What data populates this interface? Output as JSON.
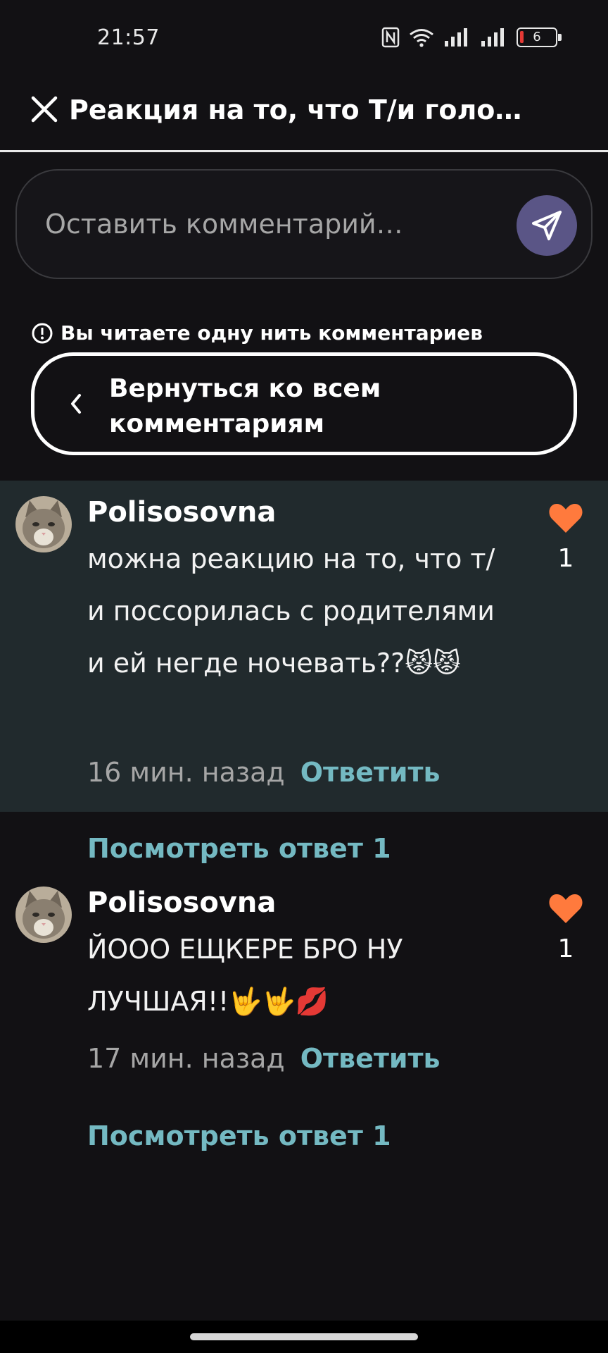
{
  "status_bar": {
    "time": "21:57",
    "battery": "6",
    "icons": [
      "nfc-icon",
      "wifi-icon",
      "signal-icon",
      "signal-icon",
      "battery-icon"
    ]
  },
  "header": {
    "title": "Реакция на то, что Т/и голо…",
    "close_icon": "close-icon"
  },
  "composer": {
    "placeholder": "Оставить комментарий…",
    "send_icon": "send-icon"
  },
  "thread": {
    "notice": "Вы читаете одну нить комментариев",
    "back_label": "Вернуться ко всем комментариям"
  },
  "comments": [
    {
      "author": "Polisosovna",
      "text": "можна реакцию на то, что т/и поссорилась с родителями и ей негде ночевать??😾😾",
      "time": "16 мин. назад",
      "reply_label": "Ответить",
      "likes": "1",
      "view_replies": "Посмотреть ответ 1"
    },
    {
      "author": "Polisosovna",
      "text": "ЙООО ЕЩКЕРЕ БРО НУ ЛУЧШАЯ!!🤟🤟💋",
      "time": "17 мин. назад",
      "reply_label": "Ответить",
      "likes": "1",
      "view_replies": "Посмотреть ответ 1"
    }
  ],
  "colors": {
    "background": "#121114",
    "highlight": "#212a2d",
    "link": "#74b9c2",
    "heart": "#ff7a3d",
    "send_button": "#5a5586"
  }
}
